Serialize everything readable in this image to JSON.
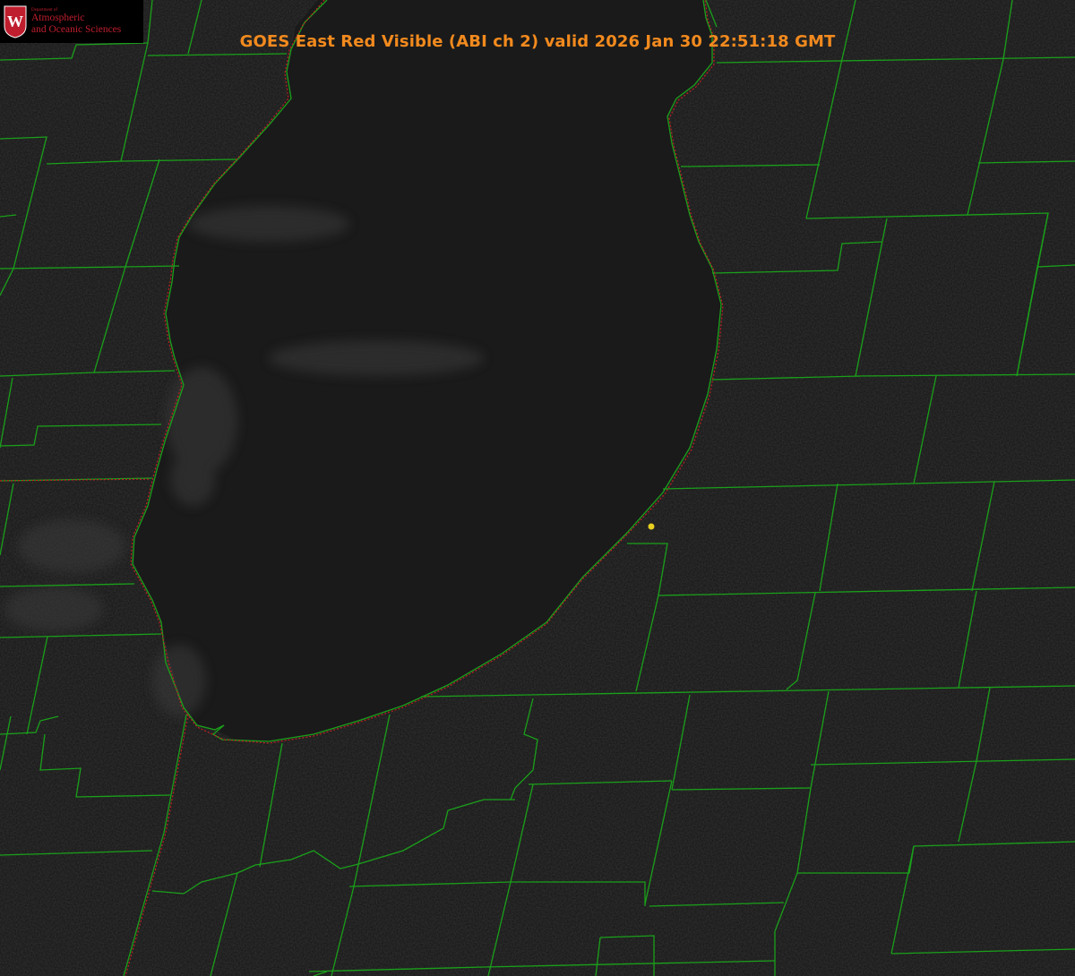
{
  "title": "GOES East Red Visible (ABI ch 2) valid 2026 Jan 30 22:51:18 GMT",
  "logo": {
    "department": "Department of",
    "line1": "Atmospheric",
    "line2": "and Oceanic Sciences",
    "seal_letter": "W"
  },
  "colors": {
    "background": "#141414",
    "lake": "#1a1a1a",
    "county_lines": "#1aa01a",
    "state_lines": "#c02020",
    "title": "#f28a1e",
    "logo_red": "#bf1e2e",
    "marker": "#e8d020"
  },
  "legend": {}
}
